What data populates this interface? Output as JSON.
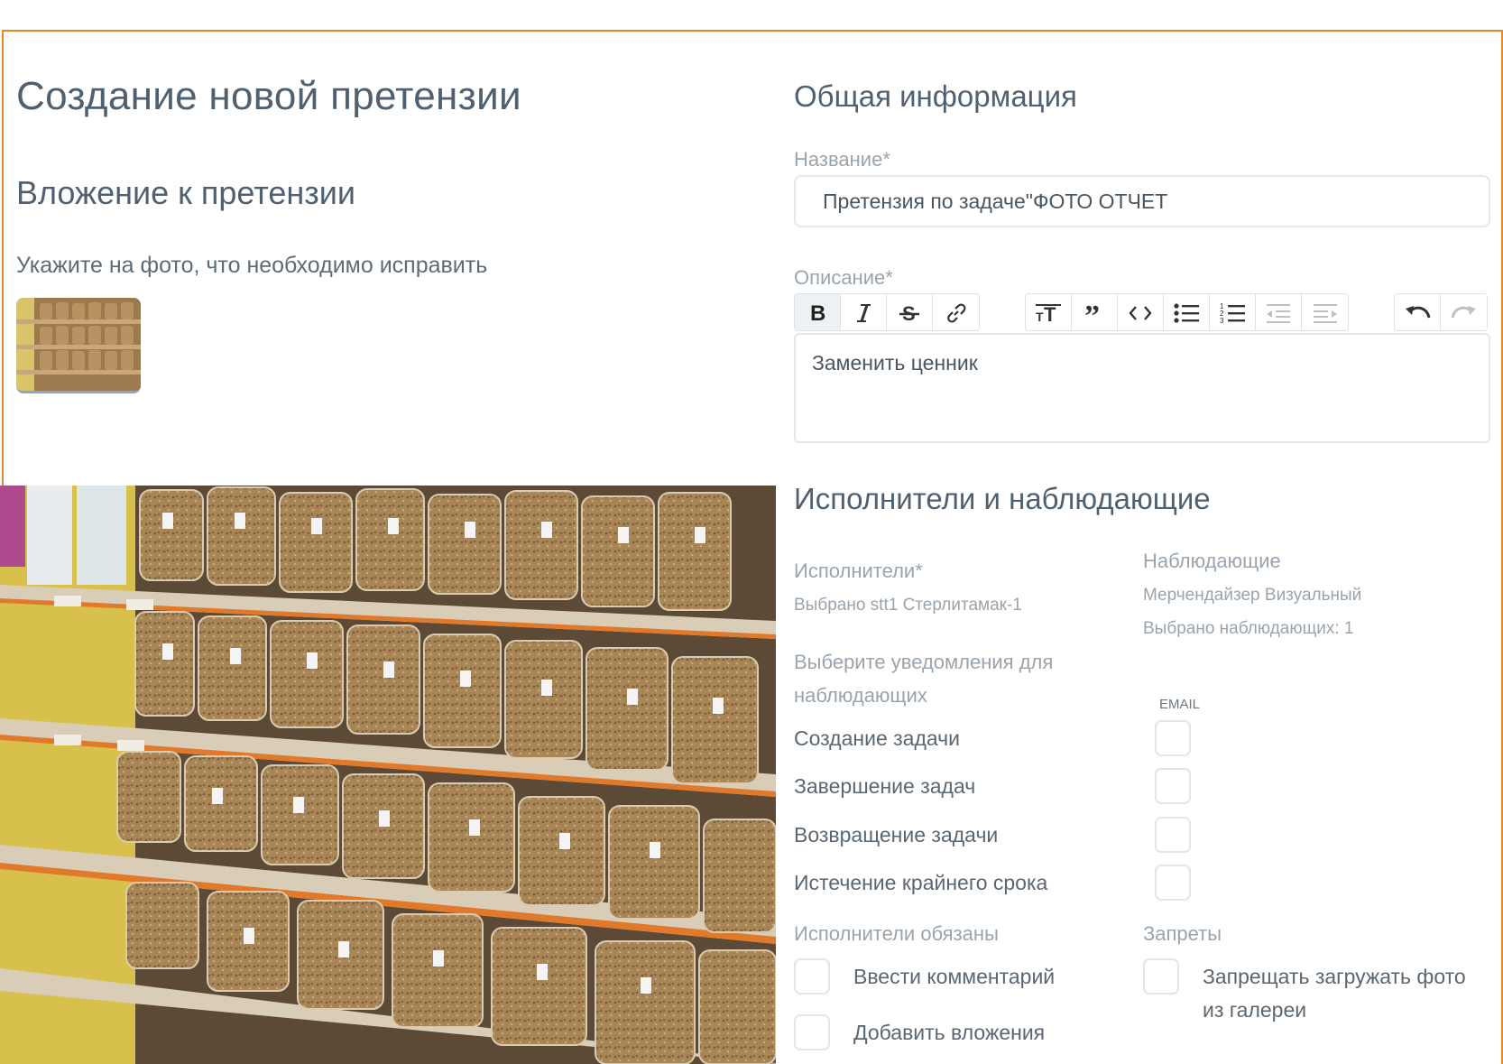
{
  "page": {
    "title": "Создание новой претензии",
    "attachment_title": "Вложение к претензии",
    "attachment_hint": "Укажите на фото, что необходимо исправить"
  },
  "general": {
    "title": "Общая информация",
    "name_label": "Название*",
    "name_value": "Претензия по задаче\"ФОТО ОТЧЕТ",
    "description_label": "Описание*",
    "description_value": "Заменить ценник"
  },
  "toolbar": {
    "icons": [
      "bold-icon",
      "italic-icon",
      "strikethrough-icon",
      "link-icon",
      "heading-icon",
      "quote-icon",
      "code-icon",
      "bullet-list-icon",
      "numbered-list-icon",
      "outdent-icon",
      "indent-icon",
      "undo-icon",
      "redo-icon"
    ]
  },
  "people": {
    "title": "Исполнители и наблюдающие",
    "executors_label": "Исполнители*",
    "executors_selected": "Выбрано stt1 Стерлитамак-1",
    "watchers_label": "Наблюдающие",
    "watchers_name": "Мерчендайзер Визуальный",
    "watchers_count": "Выбрано наблюдающих: 1",
    "notify_label_1": "Выберите уведомления для",
    "notify_label_2": "наблюдающих",
    "email_label": "EMAIL",
    "notifications": [
      {
        "label": "Создание задачи",
        "checked": false
      },
      {
        "label": "Завершение задач",
        "checked": false
      },
      {
        "label": "Возвращение задачи",
        "checked": false
      },
      {
        "label": "Истечение крайнего срока",
        "checked": false
      }
    ],
    "obliged_label": "Исполнители обязаны",
    "obliged": [
      {
        "label": "Ввести комментарий",
        "checked": false
      },
      {
        "label": "Добавить вложения",
        "checked": false
      }
    ],
    "bans_label": "Запреты",
    "bans": [
      {
        "label_1": "Запрещать загружать фото",
        "label_2": "из галереи",
        "checked": false
      }
    ]
  },
  "colors": {
    "accent_border": "#e08a2b",
    "heading": "#4f6170",
    "muted": "#9aa4ad"
  }
}
